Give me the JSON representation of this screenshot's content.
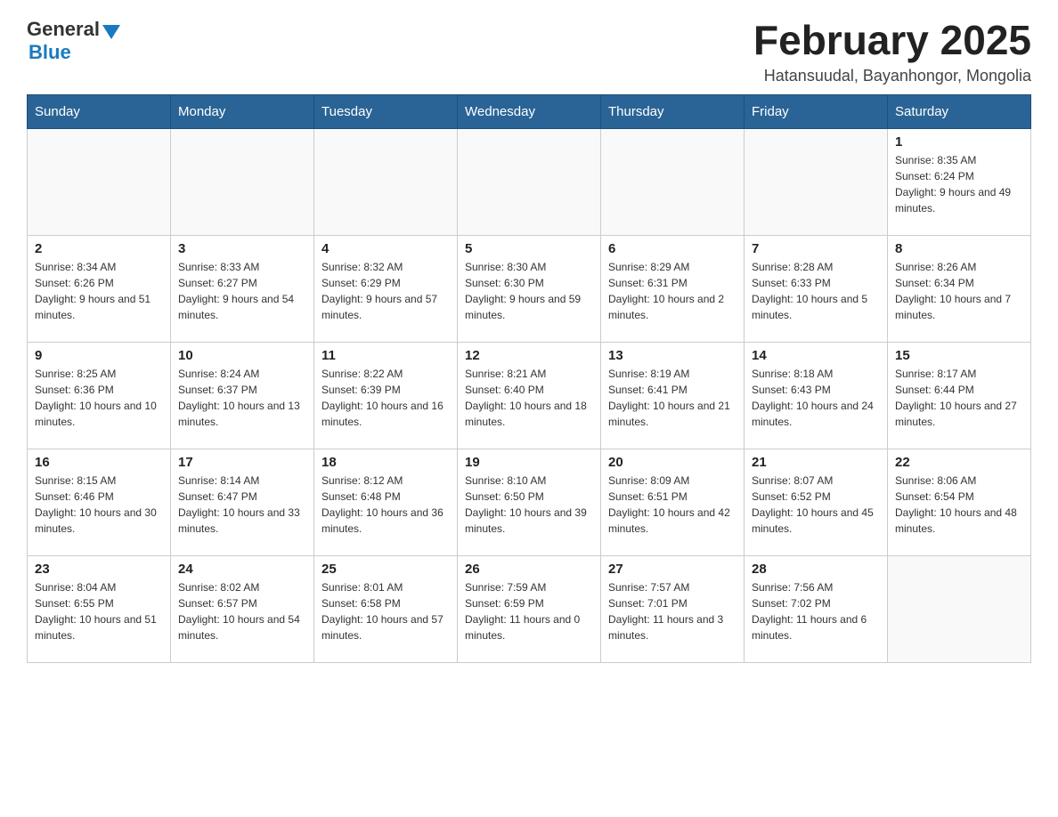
{
  "header": {
    "logo": {
      "general": "General",
      "blue": "Blue"
    },
    "title": "February 2025",
    "subtitle": "Hatansuudal, Bayanhongor, Mongolia"
  },
  "calendar": {
    "days_of_week": [
      "Sunday",
      "Monday",
      "Tuesday",
      "Wednesday",
      "Thursday",
      "Friday",
      "Saturday"
    ],
    "weeks": [
      [
        {
          "day": "",
          "info": ""
        },
        {
          "day": "",
          "info": ""
        },
        {
          "day": "",
          "info": ""
        },
        {
          "day": "",
          "info": ""
        },
        {
          "day": "",
          "info": ""
        },
        {
          "day": "",
          "info": ""
        },
        {
          "day": "1",
          "info": "Sunrise: 8:35 AM\nSunset: 6:24 PM\nDaylight: 9 hours and 49 minutes."
        }
      ],
      [
        {
          "day": "2",
          "info": "Sunrise: 8:34 AM\nSunset: 6:26 PM\nDaylight: 9 hours and 51 minutes."
        },
        {
          "day": "3",
          "info": "Sunrise: 8:33 AM\nSunset: 6:27 PM\nDaylight: 9 hours and 54 minutes."
        },
        {
          "day": "4",
          "info": "Sunrise: 8:32 AM\nSunset: 6:29 PM\nDaylight: 9 hours and 57 minutes."
        },
        {
          "day": "5",
          "info": "Sunrise: 8:30 AM\nSunset: 6:30 PM\nDaylight: 9 hours and 59 minutes."
        },
        {
          "day": "6",
          "info": "Sunrise: 8:29 AM\nSunset: 6:31 PM\nDaylight: 10 hours and 2 minutes."
        },
        {
          "day": "7",
          "info": "Sunrise: 8:28 AM\nSunset: 6:33 PM\nDaylight: 10 hours and 5 minutes."
        },
        {
          "day": "8",
          "info": "Sunrise: 8:26 AM\nSunset: 6:34 PM\nDaylight: 10 hours and 7 minutes."
        }
      ],
      [
        {
          "day": "9",
          "info": "Sunrise: 8:25 AM\nSunset: 6:36 PM\nDaylight: 10 hours and 10 minutes."
        },
        {
          "day": "10",
          "info": "Sunrise: 8:24 AM\nSunset: 6:37 PM\nDaylight: 10 hours and 13 minutes."
        },
        {
          "day": "11",
          "info": "Sunrise: 8:22 AM\nSunset: 6:39 PM\nDaylight: 10 hours and 16 minutes."
        },
        {
          "day": "12",
          "info": "Sunrise: 8:21 AM\nSunset: 6:40 PM\nDaylight: 10 hours and 18 minutes."
        },
        {
          "day": "13",
          "info": "Sunrise: 8:19 AM\nSunset: 6:41 PM\nDaylight: 10 hours and 21 minutes."
        },
        {
          "day": "14",
          "info": "Sunrise: 8:18 AM\nSunset: 6:43 PM\nDaylight: 10 hours and 24 minutes."
        },
        {
          "day": "15",
          "info": "Sunrise: 8:17 AM\nSunset: 6:44 PM\nDaylight: 10 hours and 27 minutes."
        }
      ],
      [
        {
          "day": "16",
          "info": "Sunrise: 8:15 AM\nSunset: 6:46 PM\nDaylight: 10 hours and 30 minutes."
        },
        {
          "day": "17",
          "info": "Sunrise: 8:14 AM\nSunset: 6:47 PM\nDaylight: 10 hours and 33 minutes."
        },
        {
          "day": "18",
          "info": "Sunrise: 8:12 AM\nSunset: 6:48 PM\nDaylight: 10 hours and 36 minutes."
        },
        {
          "day": "19",
          "info": "Sunrise: 8:10 AM\nSunset: 6:50 PM\nDaylight: 10 hours and 39 minutes."
        },
        {
          "day": "20",
          "info": "Sunrise: 8:09 AM\nSunset: 6:51 PM\nDaylight: 10 hours and 42 minutes."
        },
        {
          "day": "21",
          "info": "Sunrise: 8:07 AM\nSunset: 6:52 PM\nDaylight: 10 hours and 45 minutes."
        },
        {
          "day": "22",
          "info": "Sunrise: 8:06 AM\nSunset: 6:54 PM\nDaylight: 10 hours and 48 minutes."
        }
      ],
      [
        {
          "day": "23",
          "info": "Sunrise: 8:04 AM\nSunset: 6:55 PM\nDaylight: 10 hours and 51 minutes."
        },
        {
          "day": "24",
          "info": "Sunrise: 8:02 AM\nSunset: 6:57 PM\nDaylight: 10 hours and 54 minutes."
        },
        {
          "day": "25",
          "info": "Sunrise: 8:01 AM\nSunset: 6:58 PM\nDaylight: 10 hours and 57 minutes."
        },
        {
          "day": "26",
          "info": "Sunrise: 7:59 AM\nSunset: 6:59 PM\nDaylight: 11 hours and 0 minutes."
        },
        {
          "day": "27",
          "info": "Sunrise: 7:57 AM\nSunset: 7:01 PM\nDaylight: 11 hours and 3 minutes."
        },
        {
          "day": "28",
          "info": "Sunrise: 7:56 AM\nSunset: 7:02 PM\nDaylight: 11 hours and 6 minutes."
        },
        {
          "day": "",
          "info": ""
        }
      ]
    ]
  }
}
